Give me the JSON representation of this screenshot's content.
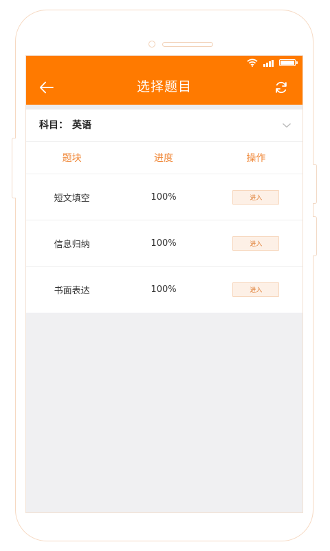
{
  "header": {
    "title": "选择题目"
  },
  "subject": {
    "label": "科目：",
    "value": "英语"
  },
  "table": {
    "columns": [
      "题块",
      "进度",
      "操作"
    ],
    "rows": [
      {
        "name": "短文填空",
        "progress": "100%",
        "action": "进入"
      },
      {
        "name": "信息归纳",
        "progress": "100%",
        "action": "进入"
      },
      {
        "name": "书面表达",
        "progress": "100%",
        "action": "进入"
      }
    ]
  },
  "colors": {
    "accent": "#ff7a00",
    "header_text": "#f08a3c",
    "button_bg": "#fdf0e6"
  },
  "icons": {
    "back": "arrow-left-icon",
    "refresh": "refresh-icon",
    "dropdown": "chevron-down-icon"
  },
  "status": {
    "battery_level": 1.0,
    "signal_level": 1.0
  }
}
